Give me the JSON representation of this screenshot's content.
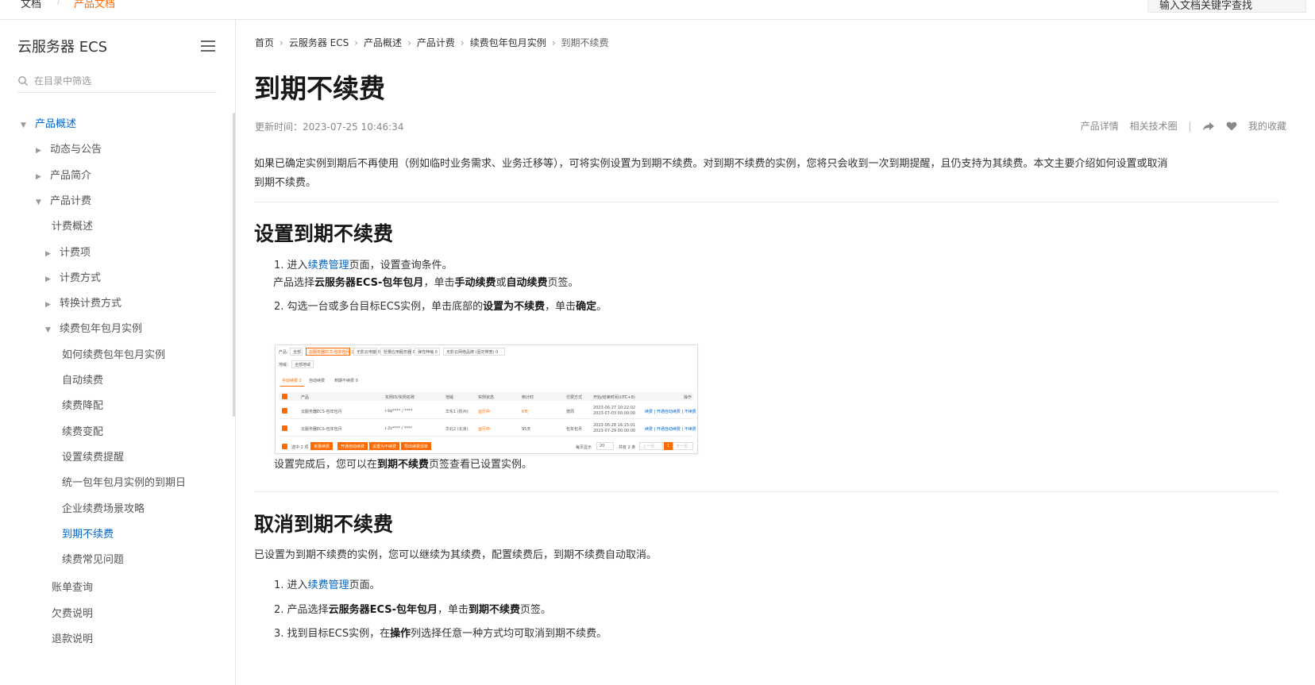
{
  "topbar": {
    "docs_label": "文档",
    "separator": "/",
    "product_docs_label": "产品文档",
    "search_placeholder": "输入文档关键字查找"
  },
  "sidebar": {
    "title": "云服务器 ECS",
    "filter_placeholder": "在目录中筛选",
    "items": [
      {
        "label": "产品概述",
        "level": 0,
        "arrow": "down",
        "active": true
      },
      {
        "label": "动态与公告",
        "level": 1,
        "arrow": "right"
      },
      {
        "label": "产品简介",
        "level": 1,
        "arrow": "right"
      },
      {
        "label": "产品计费",
        "level": 1,
        "arrow": "down"
      },
      {
        "label": "计费概述",
        "level": 2,
        "arrow": "none"
      },
      {
        "label": "计费项",
        "level": 2,
        "arrow": "right"
      },
      {
        "label": "计费方式",
        "level": 2,
        "arrow": "right"
      },
      {
        "label": "转换计费方式",
        "level": 2,
        "arrow": "right"
      },
      {
        "label": "续费包年包月实例",
        "level": 2,
        "arrow": "down"
      },
      {
        "label": "如何续费包年包月实例",
        "level": 3,
        "arrow": "none"
      },
      {
        "label": "自动续费",
        "level": 3,
        "arrow": "none"
      },
      {
        "label": "续费降配",
        "level": 3,
        "arrow": "none"
      },
      {
        "label": "续费变配",
        "level": 3,
        "arrow": "none"
      },
      {
        "label": "设置续费提醒",
        "level": 3,
        "arrow": "none"
      },
      {
        "label": "统一包年包月实例的到期日",
        "level": 3,
        "arrow": "none"
      },
      {
        "label": "企业续费场景攻略",
        "level": 3,
        "arrow": "none"
      },
      {
        "label": "到期不续费",
        "level": 3,
        "arrow": "none",
        "active": true
      },
      {
        "label": "续费常见问题",
        "level": 3,
        "arrow": "none"
      },
      {
        "label": "账单查询",
        "level": 2,
        "arrow": "none"
      },
      {
        "label": "欠费说明",
        "level": 2,
        "arrow": "none"
      },
      {
        "label": "退款说明",
        "level": 2,
        "arrow": "none"
      }
    ]
  },
  "breadcrumb": [
    "首页",
    "云服务器 ECS",
    "产品概述",
    "产品计费",
    "续费包年包月实例",
    "到期不续费"
  ],
  "page": {
    "title": "到期不续费",
    "updated": "更新时间：2023-07-25 10:46:34",
    "tools": {
      "product_details": "产品详情",
      "tech_circle": "相关技术圈",
      "separator": "|",
      "favorites": "我的收藏",
      "share_icon": "share-icon",
      "heart_icon": "heart-icon"
    },
    "intro_line1": "如果已确定实例到期后不再使用（例如临时业务需求、业务迁移等），可将实例设置为到期不续费。对到期不续费的实例，您将只会收到一次到期提醒，且仍支持为其续费。本文主要介绍如何设置或取消",
    "intro_line2": "到期不续费。"
  },
  "section1": {
    "heading": "设置到期不续费",
    "step1": {
      "num": "1.",
      "pre": "进入",
      "link": "续费管理",
      "post": "页面，设置查询条件。"
    },
    "step1_sub": {
      "pre": "产品选择",
      "b1": "云服务器ECS-包年包月",
      "mid": "，单击",
      "b2": "手动续费",
      "or": "或",
      "b3": "自动续费",
      "post": "页签。"
    },
    "step2": {
      "num": "2.",
      "pre": "勾选一台或多台目标ECS实例，单击底部的",
      "b1": "设置为不续费",
      "mid": "，单击",
      "b2": "确定",
      "post": "。"
    },
    "after": {
      "pre": "设置完成后，您可以在",
      "b": "到期不续费",
      "post": "页签查看已设置实例。"
    }
  },
  "section2": {
    "heading": "取消到期不续费",
    "intro": "已设置为到期不续费的实例，您可以继续为其续费，配置续费后，到期不续费自动取消。",
    "step1": {
      "num": "1.",
      "pre": "进入",
      "link": "续费管理",
      "post": "页面。"
    },
    "step2": {
      "num": "2.",
      "pre": "产品选择",
      "b1": "云服务器ECS-包年包月",
      "mid": "，单击",
      "b2": "到期不续费",
      "post": "页签。"
    },
    "step3": {
      "num": "3.",
      "pre": "找到目标ECS实例，在",
      "b1": "操作",
      "post": "列选择任意一种方式均可取消到期不续费。"
    }
  },
  "screenshot": {
    "product_label": "产品：",
    "chips": [
      "全部",
      "云服务器ECS-包年包月 2",
      "无影云电脑 0",
      "轻量应用服务器 0",
      "弹性伸缩 0",
      "无影云网络品牌 (固定带宽) 0"
    ],
    "region_label": "地域：",
    "region_value": "全部地域",
    "tabs": [
      "手动续费 2",
      "自动续费",
      "到期不续费 0"
    ],
    "columns": [
      "产品",
      "实例ID/实例名称",
      "地域",
      "实例状态",
      "倒计时",
      "付费方式",
      "开始/结束时间(UTC+8)",
      "操作"
    ],
    "rows": [
      {
        "product": "云服务器ECS-包年包月",
        "id": "i-bp**** / ****",
        "region": "华东1 (杭州)",
        "status": "运行中",
        "countdown": "6天",
        "pay": "按周",
        "times": [
          "2023-06-27 10:22:02",
          "2023-07-03 00:00:00"
        ],
        "ops": "续费 | 开通自动续费 | 不续费"
      },
      {
        "product": "云服务器ECS-包年包月",
        "id": "i-2z**** / ****",
        "region": "华北2 (北京)",
        "status": "运行中",
        "countdown": "95天",
        "pay": "包年包月",
        "times": [
          "2023-06-28 16:15:01",
          "2023-07-29 00:00:00"
        ],
        "ops": "续费 | 开通自动续费 | 不续费"
      }
    ],
    "footer": {
      "selected": "选中 2 项",
      "buttons": [
        "批量续费",
        "开通自动续费",
        "设置为不续费",
        "导出续费清单"
      ],
      "per_page": "每页显示",
      "per_page_value": "20",
      "total": "共有 2 条",
      "prev": "上一页",
      "page": "1",
      "next": "下一页"
    }
  },
  "colors": {
    "accent": "#ff6a00",
    "link": "#0064c8",
    "text": "#181818"
  }
}
